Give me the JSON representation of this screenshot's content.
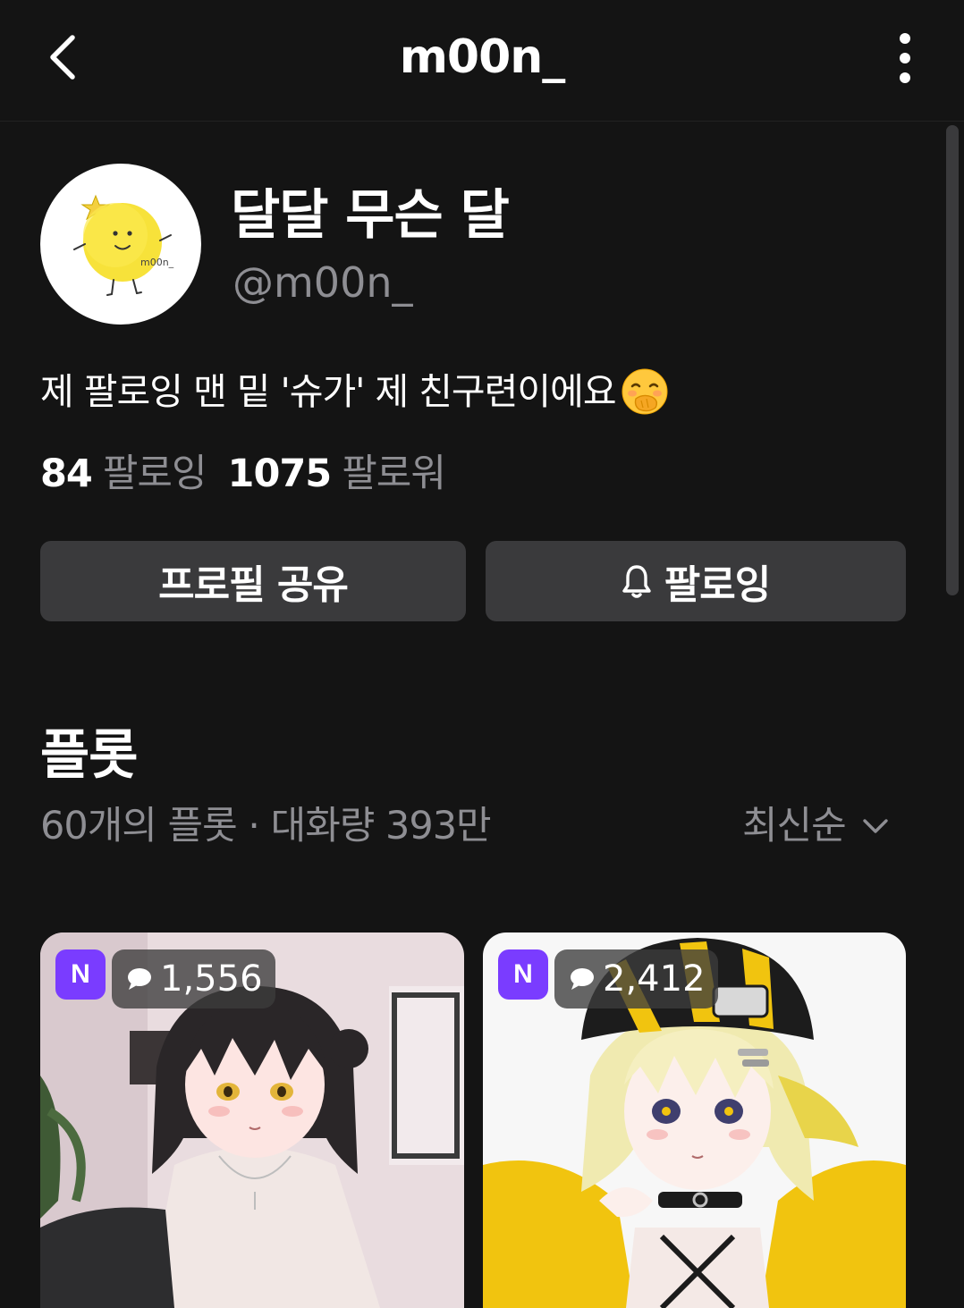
{
  "header": {
    "title": "m00n_"
  },
  "profile": {
    "display_name": "달달 무슨 달",
    "handle": "@m00n_",
    "avatar_caption": "m00n_",
    "bio": "제 팔로잉 맨 밑 '슈가' 제 친구련이에요",
    "bio_emoji": "face-with-hand-over-mouth",
    "following_count": "84",
    "following_label": "팔로잉",
    "followers_count": "1075",
    "followers_label": "팔로워"
  },
  "actions": {
    "share_label": "프로필 공유",
    "follow_label": "팔로잉"
  },
  "plots": {
    "title": "플롯",
    "meta": "60개의 플롯 · 대화량 393만",
    "sort_label": "최신순",
    "cards": [
      {
        "badge": "N",
        "count": "1,556",
        "count_icon": "chat-bubble-icon"
      },
      {
        "badge": "N",
        "count": "2,412",
        "count_icon": "chat-bubble-icon"
      }
    ]
  },
  "colors": {
    "background": "#141414",
    "button": "#3a3a3c",
    "muted_text": "#8e8e93",
    "badge": "#7a3cff"
  }
}
